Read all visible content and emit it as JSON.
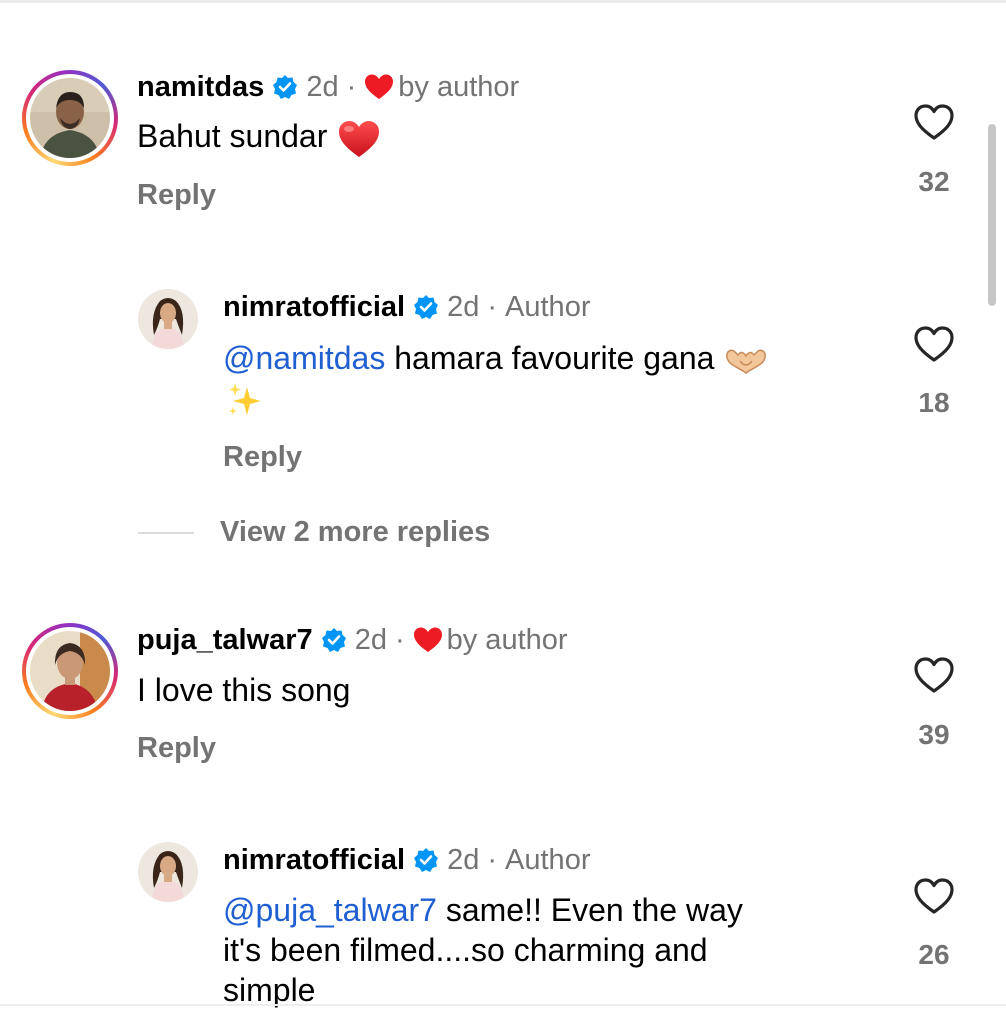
{
  "colors": {
    "mention": "#1f5fd1",
    "muted": "#737373",
    "verified": "#0095f6",
    "heart_red": "#ed1b24"
  },
  "comments": [
    {
      "username": "namitdas",
      "time": "2d",
      "separator": "·",
      "badge": "by author",
      "badge_icon": "heart-icon",
      "text": "Bahut sundar",
      "trailing_emoji": "red-heart-emoji",
      "reply_label": "Reply",
      "likes": "32"
    },
    {
      "username": "nimratofficial",
      "time": "2d",
      "separator": "·",
      "badge": "Author",
      "mention": "@namitdas",
      "text": " hamara favourite gana",
      "trailing_emoji": "heart-hands-emoji",
      "second_line_emoji": "sparkles-emoji",
      "reply_label": "Reply",
      "likes": "18"
    },
    {
      "username": "puja_talwar7",
      "time": "2d",
      "separator": "·",
      "badge": "by author",
      "badge_icon": "heart-icon",
      "text": "I love this song",
      "reply_label": "Reply",
      "likes": "39"
    },
    {
      "username": "nimratofficial",
      "time": "2d",
      "separator": "·",
      "badge": "Author",
      "mention": "@puja_talwar7",
      "text_line1": " same!! Even the way",
      "text_line2": "it's been filmed....so charming and",
      "text_line3": "simple",
      "likes": "26"
    }
  ],
  "view_more_replies": "View 2 more replies"
}
